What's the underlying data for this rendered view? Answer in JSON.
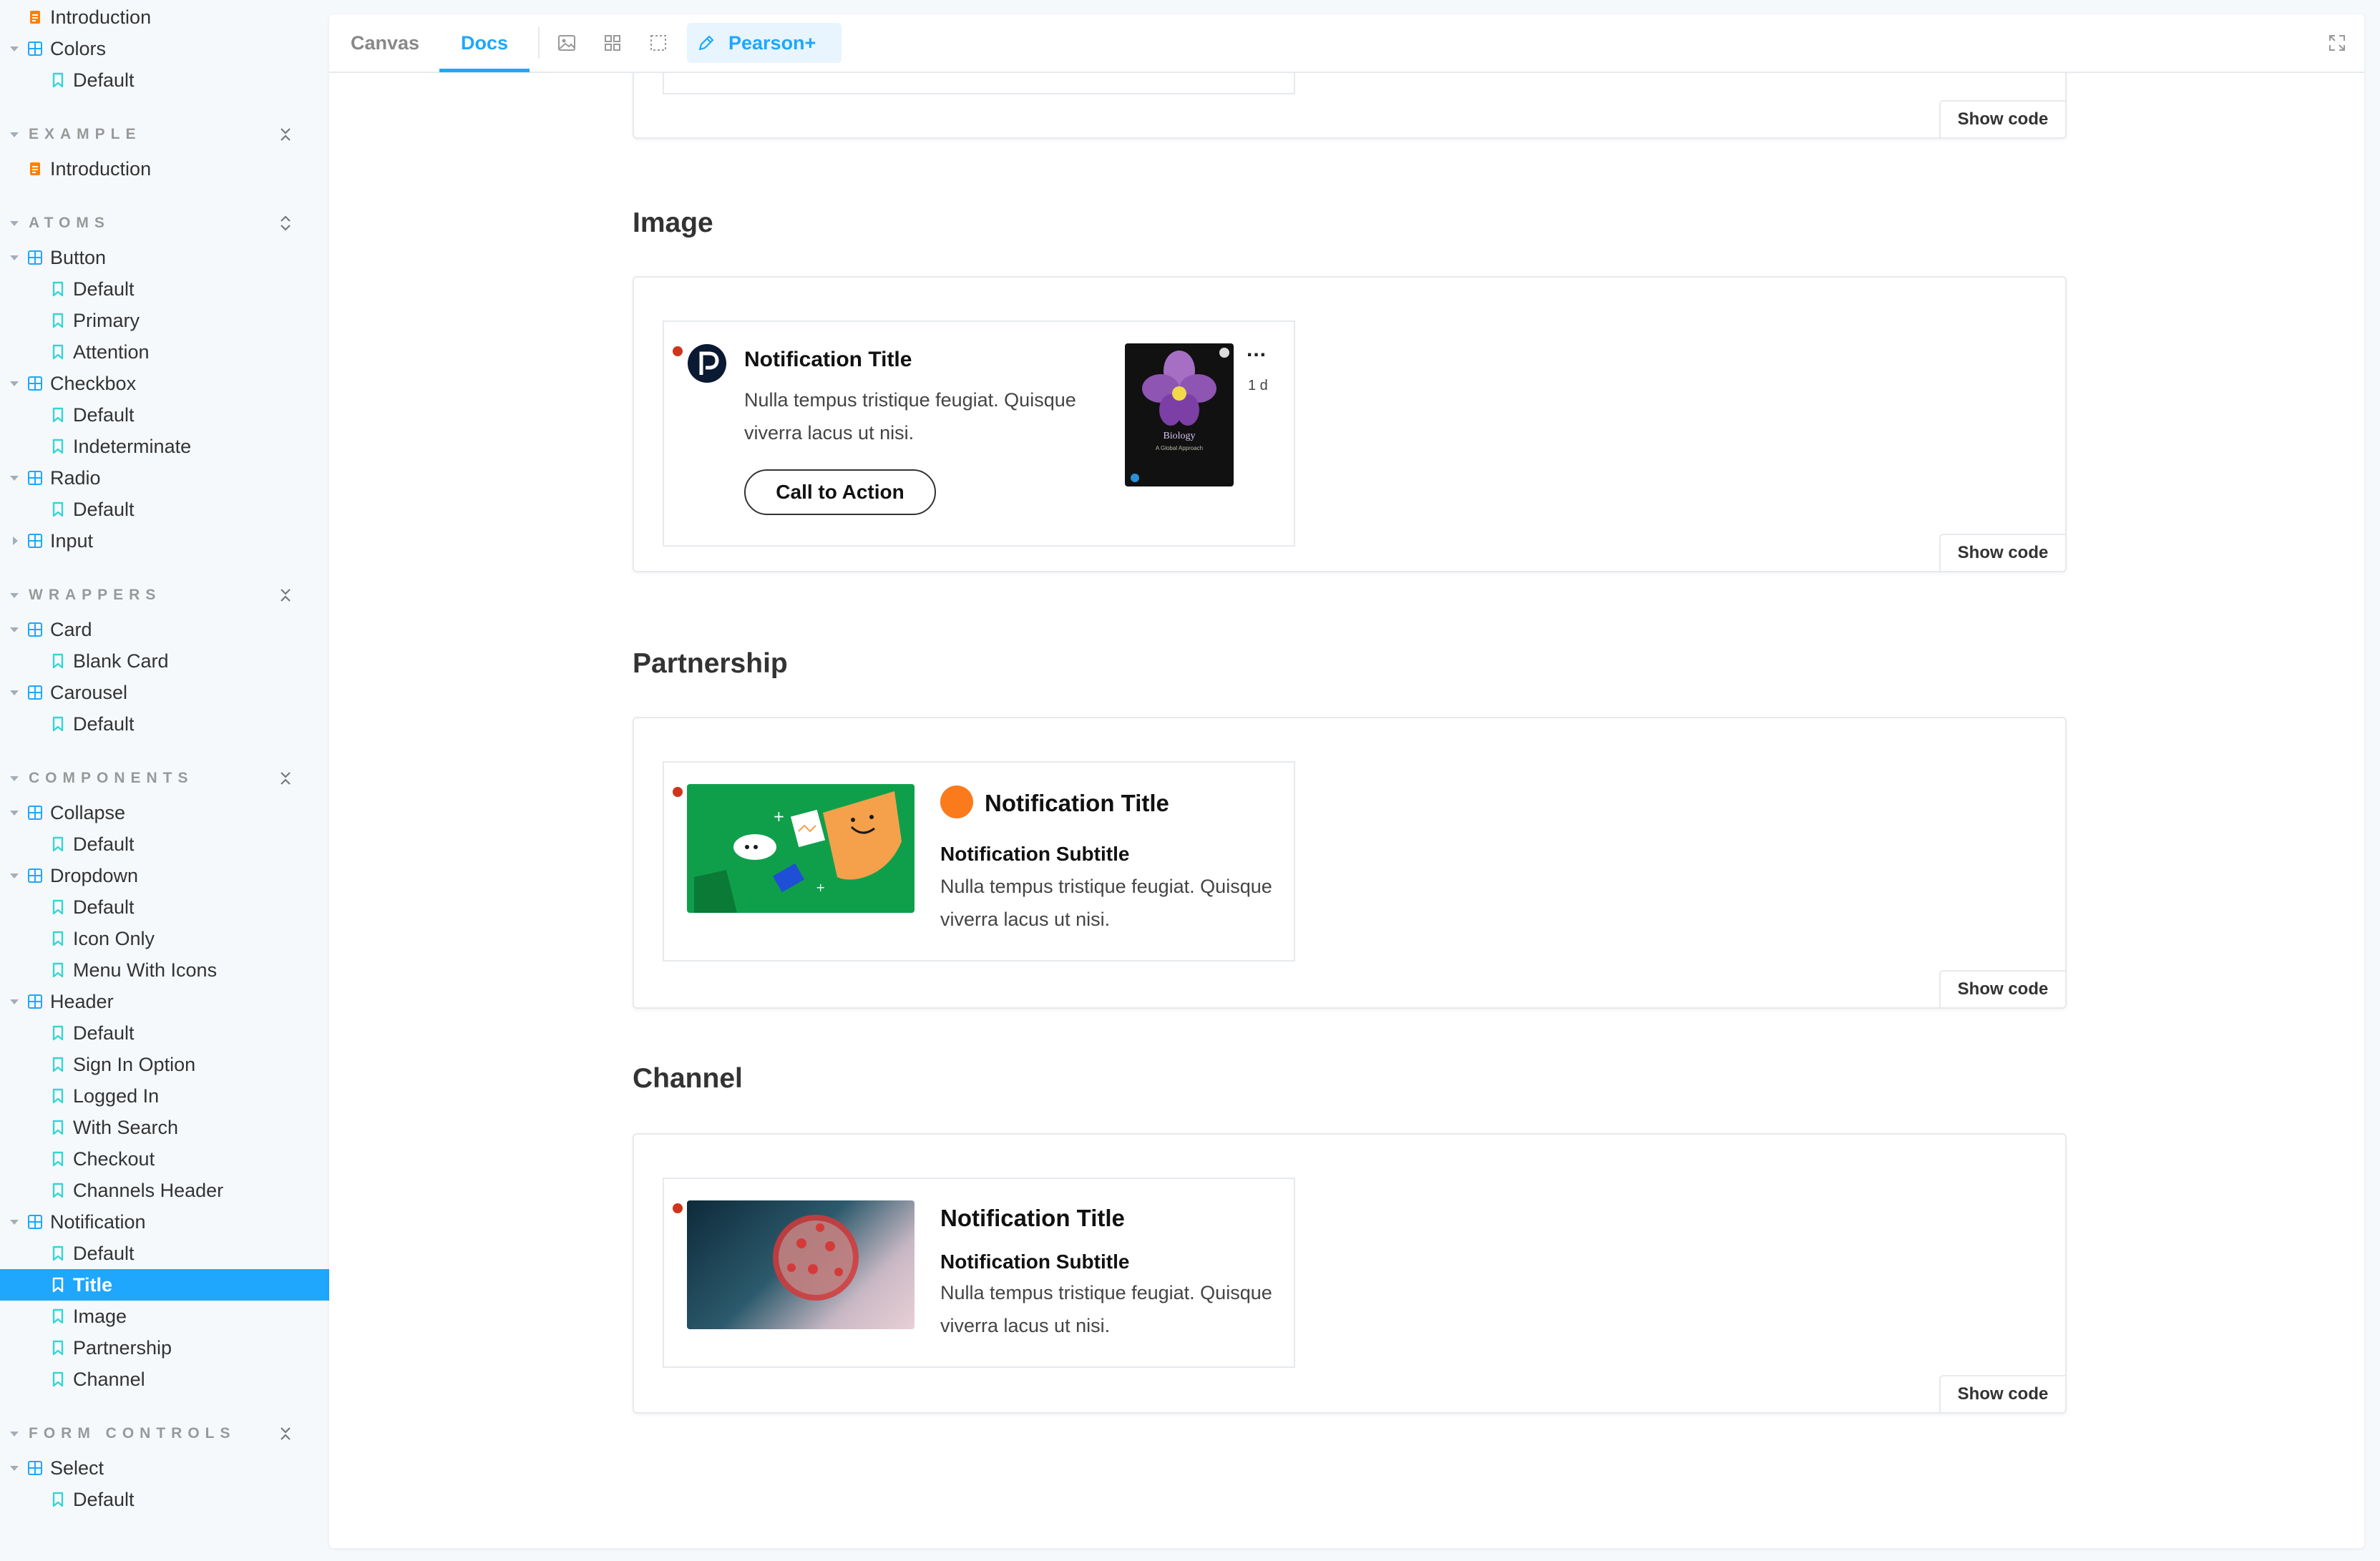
{
  "sidebar": {
    "rows": {
      "intro_top": "Introduction",
      "colors": "Colors",
      "colors_default": "Default",
      "example_intro": "Introduction",
      "button": "Button",
      "button_default": "Default",
      "button_primary": "Primary",
      "button_attention": "Attention",
      "checkbox": "Checkbox",
      "checkbox_default": "Default",
      "checkbox_indeterminate": "Indeterminate",
      "radio": "Radio",
      "radio_default": "Default",
      "input": "Input",
      "card": "Card",
      "card_blank": "Blank Card",
      "carousel": "Carousel",
      "carousel_default": "Default",
      "collapse": "Collapse",
      "collapse_default": "Default",
      "dropdown": "Dropdown",
      "dropdown_default": "Default",
      "dropdown_icon_only": "Icon Only",
      "dropdown_menu_icons": "Menu With Icons",
      "header": "Header",
      "header_default": "Default",
      "header_sign_in": "Sign In Option",
      "header_logged_in": "Logged In",
      "header_with_search": "With Search",
      "header_checkout": "Checkout",
      "header_channels": "Channels Header",
      "notification": "Notification",
      "notification_default": "Default",
      "notification_title": "Title",
      "notification_image": "Image",
      "notification_partnership": "Partnership",
      "notification_channel": "Channel",
      "select": "Select",
      "select_default": "Default"
    },
    "sections": {
      "example": "EXAMPLE",
      "atoms": "ATOMS",
      "wrappers": "WRAPPERS",
      "components": "COMPONENTS",
      "form_controls": "FORM CONTROLS"
    }
  },
  "toolbar": {
    "tab_canvas": "Canvas",
    "tab_docs": "Docs",
    "addon_tab": "Pearson+"
  },
  "docs": {
    "show_code": "Show code",
    "image": {
      "heading": "Image",
      "title": "Notification Title",
      "body": "Nulla tempus tristique feugiat. Quisque viverra lacus ut nisi.",
      "cta": "Call to Action",
      "more": "...",
      "time": "1 d",
      "book_title": "Biology",
      "book_subtitle": "A Global Approach"
    },
    "partnership": {
      "heading": "Partnership",
      "title": "Notification Title",
      "subtitle": "Notification Subtitle",
      "body": "Nulla tempus tristique feugiat. Quisque viverra lacus ut nisi."
    },
    "channel": {
      "heading": "Channel",
      "title": "Notification Title",
      "subtitle": "Notification Subtitle",
      "body": "Nulla tempus tristique feugiat. Quisque viverra lacus ut nisi."
    }
  },
  "colors": {
    "accent": "#1ea7fd",
    "story_icon": "#37d5d3",
    "doc_icon": "#ff8000",
    "component_icon": "#1ea7fd",
    "notification_dot": "#d0341d",
    "partnership_bg": "#0f9f4b",
    "partner_logo": "#fa7a1c"
  },
  "icons": {
    "doc": "document-icon",
    "component": "component-grid-icon",
    "story": "bookmark-icon",
    "collapse": "collapse-arrows-icon",
    "image_tool": "image-icon",
    "grid_tool": "grid-icon",
    "outline_tool": "outline-icon",
    "pen": "pen-icon",
    "fullscreen": "fullscreen-icon"
  }
}
